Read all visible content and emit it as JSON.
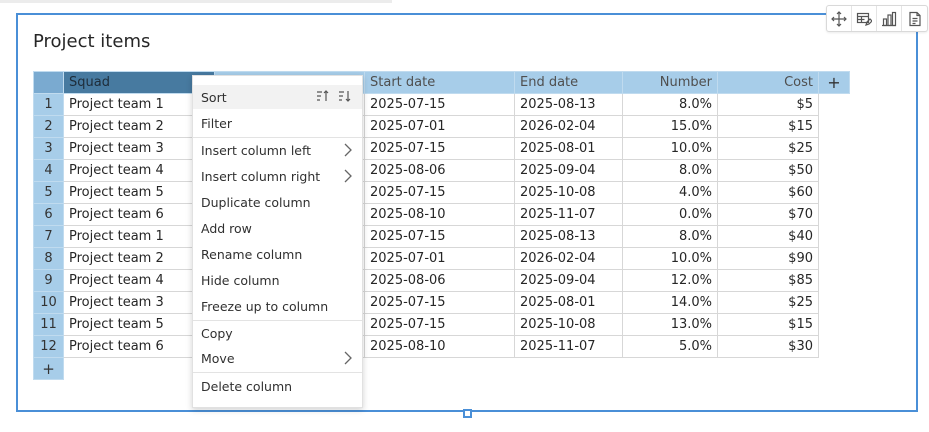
{
  "widget": {
    "title": "Project items",
    "toolbar": [
      "move-icon",
      "table-edit-icon",
      "bar-chart-icon",
      "document-icon"
    ]
  },
  "table": {
    "columns": [
      {
        "label": "Squad",
        "align": "left"
      },
      {
        "label": "",
        "align": "left"
      },
      {
        "label": "Start date",
        "align": "left"
      },
      {
        "label": "End date",
        "align": "left"
      },
      {
        "label": "Number",
        "align": "right"
      },
      {
        "label": "Cost",
        "align": "right"
      }
    ],
    "add_column_label": "+",
    "add_row_label": "+",
    "rows": [
      [
        "1",
        "Project team 1",
        "",
        "2025-07-15",
        "2025-08-13",
        "8.0%",
        "$5"
      ],
      [
        "2",
        "Project team 2",
        "",
        "2025-07-01",
        "2026-02-04",
        "15.0%",
        "$15"
      ],
      [
        "3",
        "Project team 3",
        "",
        "2025-07-15",
        "2025-08-01",
        "10.0%",
        "$25"
      ],
      [
        "4",
        "Project team 4",
        "",
        "2025-08-06",
        "2025-09-04",
        "8.0%",
        "$50"
      ],
      [
        "5",
        "Project team 5",
        "",
        "2025-07-15",
        "2025-10-08",
        "4.0%",
        "$60"
      ],
      [
        "6",
        "Project team 6",
        "",
        "2025-08-10",
        "2025-11-07",
        "0.0%",
        "$70"
      ],
      [
        "7",
        "Project team 1",
        "",
        "2025-07-15",
        "2025-08-13",
        "8.0%",
        "$40"
      ],
      [
        "8",
        "Project team 2",
        "",
        "2025-07-01",
        "2026-02-04",
        "10.0%",
        "$90"
      ],
      [
        "9",
        "Project team 4",
        "",
        "2025-08-06",
        "2025-09-04",
        "12.0%",
        "$85"
      ],
      [
        "10",
        "Project team 3",
        "",
        "2025-07-15",
        "2025-08-01",
        "14.0%",
        "$25"
      ],
      [
        "11",
        "Project team 5",
        "",
        "2025-07-15",
        "2025-10-08",
        "13.0%",
        "$15"
      ],
      [
        "12",
        "Project team 6",
        "",
        "2025-08-10",
        "2025-11-07",
        "5.0%",
        "$30"
      ]
    ]
  },
  "context_menu": {
    "sort": "Sort",
    "filter": "Filter",
    "insert_left": "Insert column left",
    "insert_right": "Insert column right",
    "duplicate": "Duplicate column",
    "add_row": "Add row",
    "rename": "Rename column",
    "hide": "Hide column",
    "freeze": "Freeze up to column",
    "copy": "Copy",
    "move": "Move",
    "delete": "Delete column"
  },
  "colors": {
    "accent": "#4a8fd7",
    "header_bg": "#a7cde9",
    "selected_header_bg": "#477aa0"
  }
}
